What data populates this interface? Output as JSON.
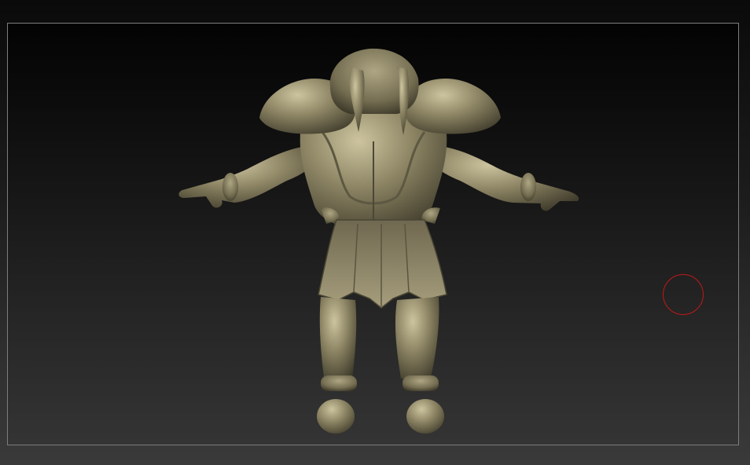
{
  "viewport": {
    "model_name": "",
    "colors": {
      "background_top": "#030303",
      "background_bottom": "#343434",
      "frame_border": "#7d7d7d",
      "material_base": "#8f8766",
      "material_highlight": "#cfc6a0",
      "material_shadow": "#3e3a2a"
    }
  },
  "brush": {
    "icon": "brush-ring-icon",
    "color": "#c21818"
  }
}
